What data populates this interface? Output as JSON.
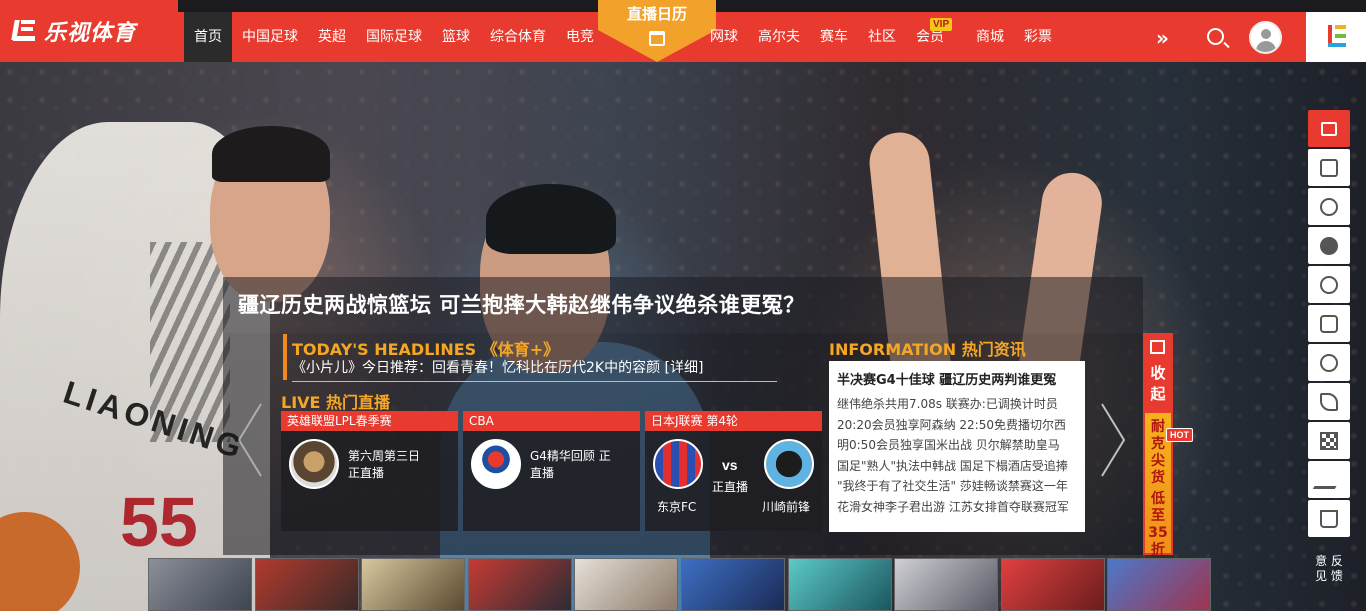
{
  "brand": {
    "logo_text": "乐视体育"
  },
  "nav": {
    "items": [
      {
        "label": "首页",
        "active": true
      },
      {
        "label": "中国足球"
      },
      {
        "label": "英超"
      },
      {
        "label": "国际足球"
      },
      {
        "label": "篮球"
      },
      {
        "label": "综合体育"
      },
      {
        "label": "电竞"
      }
    ],
    "live_calendar": "直播日历",
    "items_right": [
      {
        "label": "网球"
      },
      {
        "label": "高尔夫"
      },
      {
        "label": "赛车"
      },
      {
        "label": "社区"
      },
      {
        "label": "会员",
        "badge": "VIP"
      },
      {
        "label": "商城"
      },
      {
        "label": "彩票"
      }
    ],
    "more_icon": "double-chevron-right-icon",
    "search_icon": "search-icon",
    "avatar_icon": "user-avatar-icon"
  },
  "headline": "疆辽历史两战惊篮坛 可兰抱摔大韩赵继伟争议绝杀谁更冤？",
  "today": {
    "title": "TODAY'S HEADLINES 《体育+》",
    "line": "《小片儿》今日推荐：回看青春！忆科比在历代2K中的容颜 [详细]"
  },
  "live": {
    "title": "LIVE 热门直播",
    "cards": [
      {
        "header": "英雄联盟LPL春季赛",
        "line1": "第六周第三日",
        "line2": "正直播"
      },
      {
        "header": "CBA",
        "line1": "G4精华回顾 正",
        "line2": "直播"
      }
    ],
    "match": {
      "header": "日本J联赛 第4轮",
      "vs": "vs",
      "status": "正直播",
      "home": "东京FC",
      "away": "川崎前锋"
    }
  },
  "info": {
    "title": "INFORMATION 热门资讯",
    "lead": "半决赛G4十佳球 疆辽历史两判谁更冤",
    "lines": [
      "继伟绝杀共用7.08s 联赛办:已调换计时员",
      "20:20会员独享阿森纳 22:50免费播切尔西",
      "明0:50会员独享国米出战 贝尔解禁助皇马",
      "国足\"熟人\"执法中韩战 国足下榻酒店受追捧",
      "\"我终于有了社交生活\" 莎娃畅谈禁赛这一年",
      "花滑女神李子君出游 江苏女排首夺联赛冠军"
    ]
  },
  "collapse": {
    "w1": "收",
    "w2": "起"
  },
  "promo": {
    "hot": "HOT",
    "chars": [
      "耐",
      "克",
      "尖",
      "货",
      "低",
      "至",
      "35",
      "折"
    ]
  },
  "rail": {
    "icons": [
      "home-icon",
      "dice-icon",
      "planet-icon",
      "basketball-icon",
      "medal-icon",
      "jersey-icon",
      "tennis-icon",
      "golf-icon",
      "racing-flag-icon",
      "nike-icon",
      "cart-icon"
    ],
    "feedback": "意反\n见馈"
  }
}
